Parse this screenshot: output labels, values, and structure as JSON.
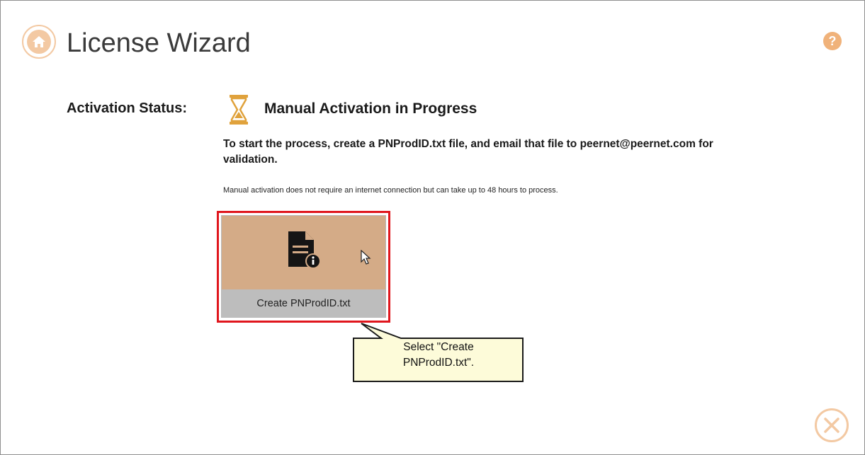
{
  "window": {
    "title": "License Wizard",
    "help_glyph": "?"
  },
  "status": {
    "label": "Activation Status:",
    "value": "Manual Activation in Progress",
    "icon": "hourglass-icon"
  },
  "instructions": "To start the process, create a PNProdID.txt file, and email that file to peernet@peernet.com for validation.",
  "note": "Manual activation does not require an internet connection but can take up to 48 hours to process.",
  "tile": {
    "label": "Create PNProdID.txt",
    "icon": "document-info-icon"
  },
  "callout": {
    "line1": "Select \"Create",
    "line2": "PNProdID.txt\"."
  },
  "colors": {
    "accent": "#f3c9a3",
    "tile_bg": "#d4ab87",
    "tile_label_bg": "#bdbdbd",
    "highlight": "#e0161d",
    "callout_bg": "#fdfbd9",
    "hourglass": "#e0a23c"
  }
}
